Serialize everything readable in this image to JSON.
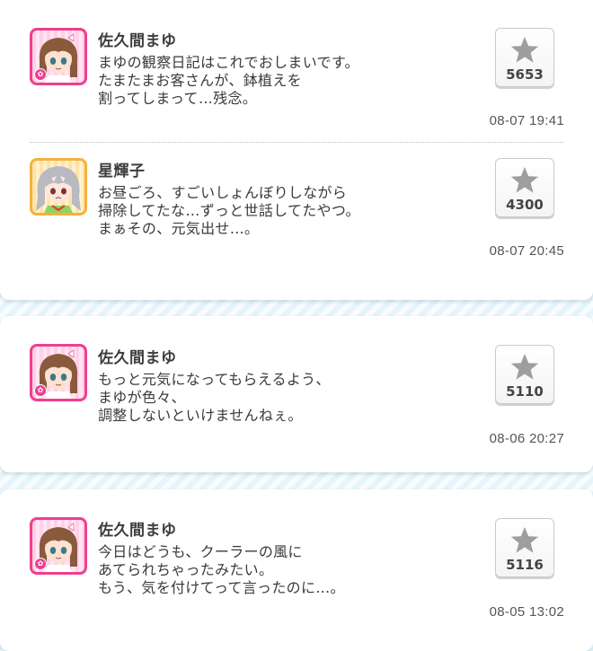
{
  "cards": [
    {
      "posts": [
        {
          "author": "佐久間まゆ",
          "lines": [
            "まゆの観察日記はこれでおしまいです。",
            "たまたまお客さんが、鉢植えを",
            "割ってしまって…残念。"
          ],
          "likes": "5653",
          "time": "08-07 19:41",
          "avatar_icon": "mayu-avatar-icon"
        },
        {
          "author": "星輝子",
          "lines": [
            "お昼ごろ、すごいしょんぼりしながら",
            "掃除してたな…ずっと世話してたやつ。",
            "まぁその、元気出せ…。"
          ],
          "likes": "4300",
          "time": "08-07 20:45",
          "avatar_icon": "syoko-avatar-icon"
        }
      ]
    },
    {
      "posts": [
        {
          "author": "佐久間まゆ",
          "lines": [
            "もっと元気になってもらえるよう、",
            "まゆが色々、",
            "調整しないといけませんねぇ。"
          ],
          "likes": "5110",
          "time": "08-06 20:27",
          "avatar_icon": "mayu-avatar-icon"
        }
      ]
    },
    {
      "posts": [
        {
          "author": "佐久間まゆ",
          "lines": [
            "今日はどうも、クーラーの風に",
            "あてられちゃったみたい。",
            "もう、気を付けてって言ったのに…。"
          ],
          "likes": "5116",
          "time": "08-05 13:02",
          "avatar_icon": "mayu-avatar-icon"
        }
      ]
    }
  ],
  "colors": {
    "background": "#e4f5fb",
    "card": "#ffffff",
    "mayu_frame": "#ee3f8f",
    "syoko_frame": "#f3b23c",
    "star": "#9e9e9e"
  }
}
